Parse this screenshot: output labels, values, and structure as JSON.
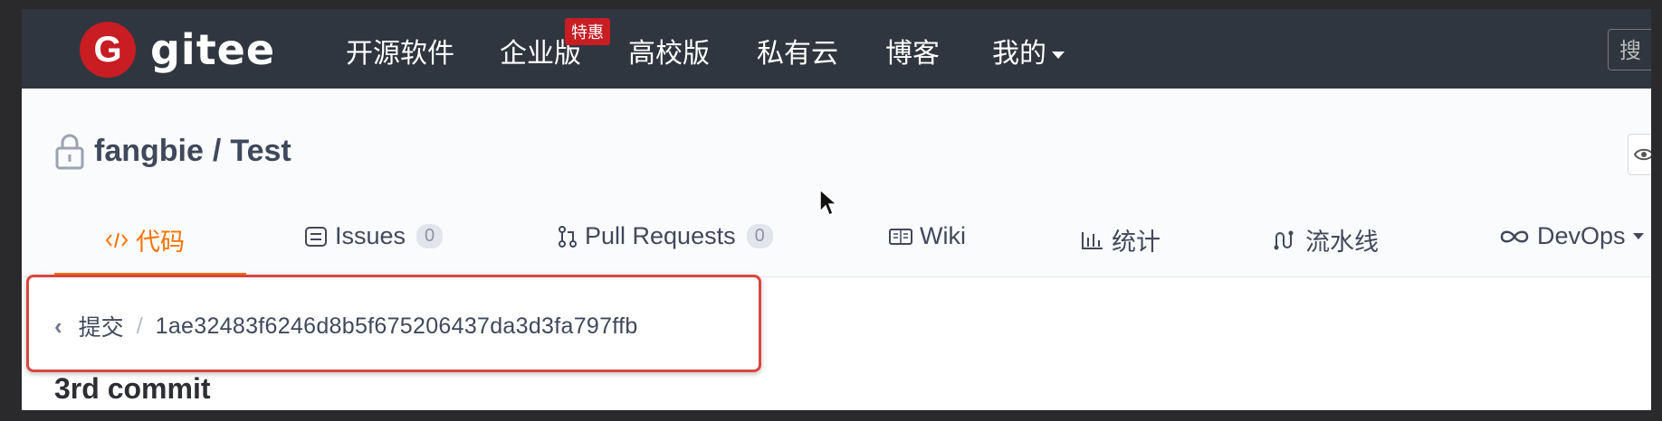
{
  "topnav": {
    "logo_letter": "G",
    "logo_text": "gitee",
    "items": [
      "开源软件",
      "企业版",
      "高校版",
      "私有云",
      "博客",
      "我的"
    ],
    "promo_badge": "特惠",
    "search_placeholder": "搜"
  },
  "repo": {
    "owner": "fangbie",
    "separator": "/",
    "name": "Test",
    "title": "fangbie / Test"
  },
  "tabs": [
    {
      "label": "代码",
      "icon": "code-icon",
      "active": true
    },
    {
      "label": "Issues",
      "icon": "issues-icon",
      "count": "0"
    },
    {
      "label": "Pull Requests",
      "icon": "pull-request-icon",
      "count": "0"
    },
    {
      "label": "Wiki",
      "icon": "wiki-icon"
    },
    {
      "label": "统计",
      "icon": "stats-icon"
    },
    {
      "label": "流水线",
      "icon": "pipeline-icon"
    },
    {
      "label": "DevOps",
      "icon": "devops-icon"
    }
  ],
  "breadcrumb": {
    "back_label": "‹",
    "parent": "提交",
    "separator": "/",
    "commit_hash": "1ae32483f6246d8b5f675206437da3d3fa797ffb"
  },
  "commit": {
    "message": "3rd commit"
  },
  "colors": {
    "nav_bg": "#30363f",
    "brand_red": "#c71d23",
    "accent_orange": "#fe7300",
    "highlight_red": "#d9473f"
  }
}
